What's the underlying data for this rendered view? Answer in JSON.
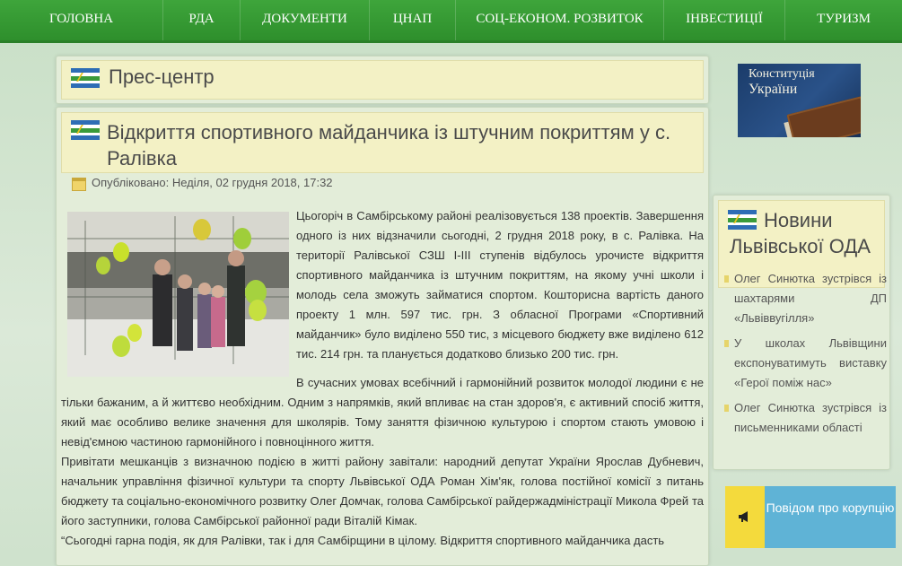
{
  "nav": {
    "items": [
      {
        "label": "ГОЛОВНА"
      },
      {
        "label": "РДА"
      },
      {
        "label": "ДОКУМЕНТИ"
      },
      {
        "label": "ЦНАП"
      },
      {
        "label": "СОЦ-ЕКОНОМ. РОЗВИТОК"
      },
      {
        "label": "ІНВЕСТИЦІЇ"
      },
      {
        "label": "ТУРИЗМ"
      }
    ]
  },
  "section": {
    "title": "Прес-центр"
  },
  "article": {
    "title": "Відкриття спортивного майданчика із штучним покриттям у с. Ралівка",
    "published": "Опубліковано: Неділя, 02 грудня 2018, 17:32",
    "p1": "Цьогоріч в Самбірському районі реалізовується 138 проектів. Завершення одного із них відзначили сьогодні, 2 грудня 2018 року, в с. Ралівка. На території Ралівської СЗШ І-ІІІ ступенів відбулось урочисте відкриття спортивного майданчика із штучним покриттям, на якому учні школи і молодь села зможуть займатися спортом. Кошторисна вартість даного проекту 1 млн. 597 тис. грн. З обласної Програми «Спортивний майданчик» було виділено 550 тис, з місцевого бюджету вже виділено 612 тис. 214 грн. та планується додатково близько 200 тис. грн.",
    "p2": "В сучасних умовах всебічний і гармонійний розвиток молодої людини є не тільки бажаним, а й життєво необхідним. Одним з напрямків, який впливає на стан здоров'я, є активний спосіб життя, який має особливо велике значення для школярів. Тому заняття фізичною культурою і спортом стають умовою і невід'ємною частиною гармонійного і повноцінного життя.",
    "p3": "Привітати мешканців з визначною подією в житті району завітали: народний депутат України Ярослав Дубневич, начальник управління фізичної культури та спорту Львівської ОДА Роман Хім'як, голова постійної комісії з питань бюджету та соціально-економічного розвитку Олег Домчак, голова Самбірської райдержадміністрації Микола Фрей та його заступники, голова Самбірської районної ради Віталій Кімак.",
    "p4": "“Сьогодні гарна подія, як для Ралівки, так і для Самбірщини в цілому. Відкриття спортивного майданчика дасть"
  },
  "constitution_banner": {
    "line1": "Конституція",
    "line2": "України"
  },
  "news": {
    "title": "Новини Львівської ОДА",
    "items": [
      {
        "text": "Олег Синютка зустрівся із шахтарями ДП «Львіввугілля»"
      },
      {
        "text": "У школах Львівщини експонуватимуть виставку «Герої поміж нас»"
      },
      {
        "text": "Олег Синютка зустрівся із письменниками області"
      }
    ]
  },
  "report": {
    "label": "Повідом про корупцію"
  },
  "colors": {
    "nav": "#3ea53b",
    "header_box": "#f3f1c5",
    "report": "#5fb3d6",
    "report_icon": "#f4da3c"
  }
}
